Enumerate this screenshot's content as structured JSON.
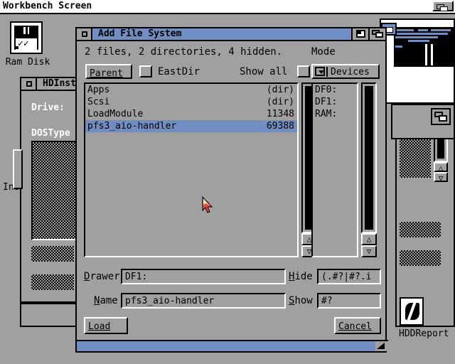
{
  "screen": {
    "title": "Workbench Screen",
    "depth_gadget_icon": "depth-gadget-icon",
    "background_color": "#a0a0a0"
  },
  "desktop": {
    "icons": [
      {
        "label": "Ram Disk",
        "icon": "floppy-disk-icon"
      },
      {
        "label": "HDDReport",
        "icon": "hddreport-tool-icon"
      }
    ]
  },
  "background_windows": [
    {
      "title": "HDInst",
      "labels": [
        "Drive:",
        "DOSType"
      ],
      "partial_text": "Ins"
    },
    {
      "title": "",
      "labels": []
    }
  ],
  "dialog": {
    "title": "Add File System",
    "close_gadget_icon": "close-gadget-icon",
    "zoom_gadget_icon": "zoom-gadget-icon",
    "depth_gadget_icon": "depth-gadget-icon",
    "size_gadget_icon": "size-gadget-icon",
    "status_text": "2 files, 2 directories, 4 hidden.",
    "parent_button": "Parent",
    "eastdir_label": "EastDir",
    "eastdir_checked": false,
    "showall_label": "Show all",
    "showall_checked": false,
    "mode_label": "Mode",
    "mode_cycle_value": "Devices",
    "mode_cycle_icon": "cycle-gadget-icon",
    "files": [
      {
        "name": "Apps",
        "size": "(dir)",
        "selected": false
      },
      {
        "name": "Scsi",
        "size": "(dir)",
        "selected": false
      },
      {
        "name": "LoadModule",
        "size": "11348",
        "selected": false
      },
      {
        "name": "pfs3_aio-handler",
        "size": "69388",
        "selected": true
      }
    ],
    "devices": [
      {
        "name": "DF0:"
      },
      {
        "name": "DF1:"
      },
      {
        "name": "RAM:"
      }
    ],
    "fields": [
      {
        "label": "Drawer",
        "accel": "D",
        "value": "DF1:"
      },
      {
        "label": "Name",
        "accel": "N",
        "value": "pfs3_aio-handler"
      }
    ],
    "filters": [
      {
        "label": "Hide",
        "accel": "H",
        "value": "(.#?|#?.i"
      },
      {
        "label": "Show",
        "accel": "S",
        "value": "#?"
      }
    ],
    "load_button": "Load",
    "cancel_button": "Cancel",
    "scroll_up_icon": "scroll-up-arrow-icon",
    "scroll_down_icon": "scroll-down-arrow-icon"
  },
  "colors": {
    "accent_blue": "#6f8fc4",
    "grey": "#a0a0a0",
    "black": "#000000",
    "white": "#ffffff",
    "cursor_red": "#e84a3c"
  }
}
